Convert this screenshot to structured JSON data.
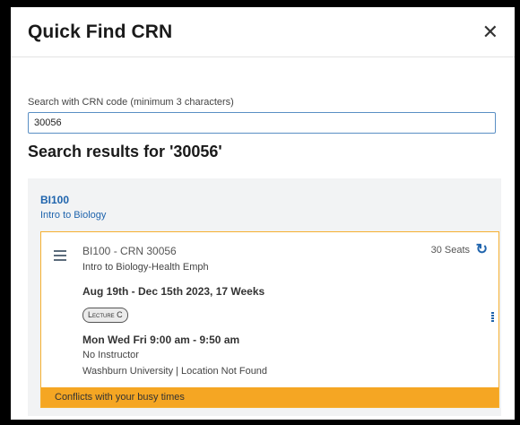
{
  "modal": {
    "title": "Quick Find CRN",
    "close_icon": "close-icon"
  },
  "search": {
    "label": "Search with CRN code (minimum 3 characters)",
    "value": "30056"
  },
  "results": {
    "heading": "Search results for '30056'",
    "course": {
      "code": "BI100",
      "name": "Intro to Biology"
    },
    "section": {
      "title": "BI100 - CRN 30056",
      "subtitle": "Intro to Biology-Health Emph",
      "seats": "30 Seats",
      "dates": "Aug 19th - Dec 15th 2023, 17 Weeks",
      "type_badge": "Lecture C",
      "meeting": "Mon Wed Fri 9:00 am - 9:50 am",
      "instructor": "No Instructor",
      "location": "Washburn University | Location Not Found",
      "conflict": "Conflicts with your busy times",
      "conflict_color": "#f5a623",
      "accent_color": "#1f64ad"
    }
  }
}
